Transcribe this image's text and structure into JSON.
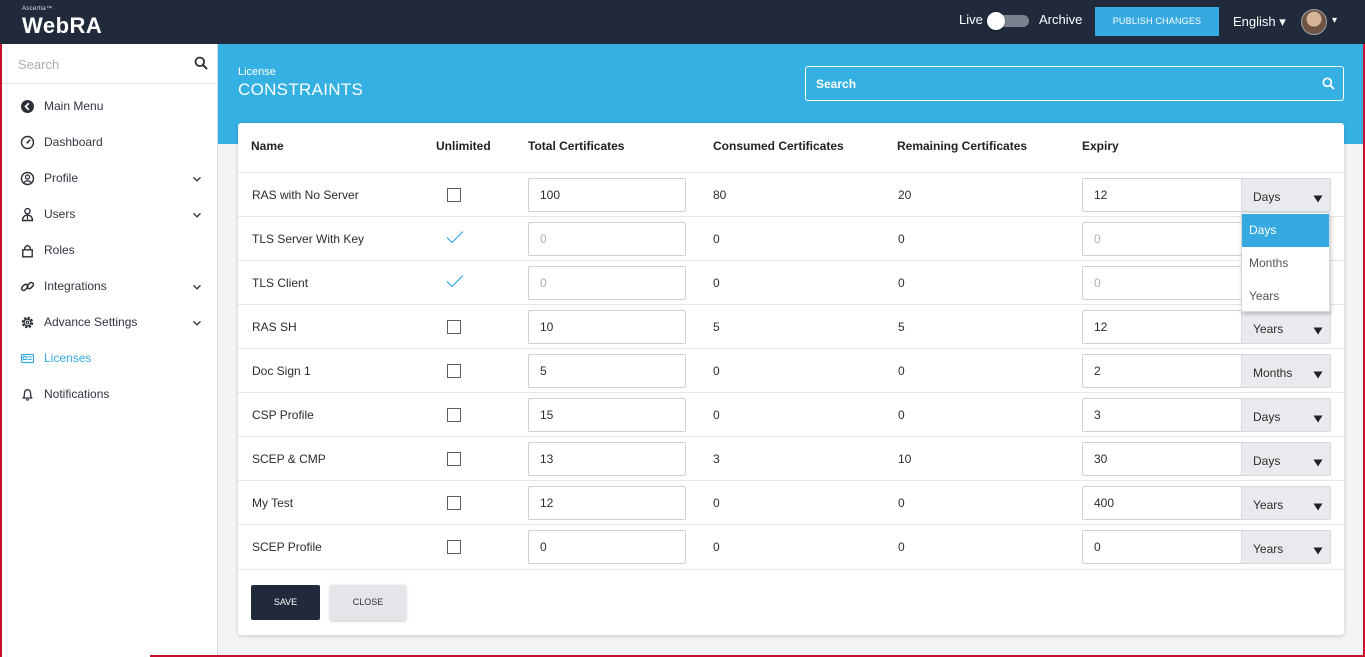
{
  "app": {
    "brand_small": "Ascertia™",
    "brand_name": "WebRA"
  },
  "topbar": {
    "live_label": "Live",
    "archive_label": "Archive",
    "publish_label": "PUBLISH CHANGES",
    "language_label": "English ▾",
    "avatar_caret": "▾"
  },
  "sidebar": {
    "search_placeholder": "Search",
    "items": [
      {
        "label": "Main Menu",
        "icon": "back-circle-icon",
        "chevron": false,
        "active": false
      },
      {
        "label": "Dashboard",
        "icon": "dashboard-gauge-icon",
        "chevron": false,
        "active": false
      },
      {
        "label": "Profile",
        "icon": "profile-icon",
        "chevron": true,
        "active": false
      },
      {
        "label": "Users",
        "icon": "users-icon",
        "chevron": true,
        "active": false
      },
      {
        "label": "Roles",
        "icon": "lock-icon",
        "chevron": false,
        "active": false
      },
      {
        "label": "Integrations",
        "icon": "link-icon",
        "chevron": true,
        "active": false
      },
      {
        "label": "Advance Settings",
        "icon": "gear-icon",
        "chevron": true,
        "active": false
      },
      {
        "label": "Licenses",
        "icon": "license-card-icon",
        "chevron": false,
        "active": true
      },
      {
        "label": "Notifications",
        "icon": "bell-icon",
        "chevron": false,
        "active": false
      }
    ]
  },
  "header": {
    "subtitle": "License",
    "title": "CONSTRAINTS",
    "search_placeholder": "Search"
  },
  "table": {
    "columns": [
      "Name",
      "Unlimited",
      "Total Certificates",
      "Consumed Certificates",
      "Remaining Certificates",
      "Expiry"
    ],
    "rows": [
      {
        "name": "RAS with No Server",
        "unlimited": false,
        "total": "100",
        "consumed": "80",
        "remaining": "20",
        "expiry": "12",
        "unit": "Days"
      },
      {
        "name": "TLS Server With Key",
        "unlimited": true,
        "total": "0",
        "consumed": "0",
        "remaining": "0",
        "expiry": "0",
        "unit": ""
      },
      {
        "name": "TLS Client",
        "unlimited": true,
        "total": "0",
        "consumed": "0",
        "remaining": "0",
        "expiry": "0",
        "unit": ""
      },
      {
        "name": "RAS SH",
        "unlimited": false,
        "total": "10",
        "consumed": "5",
        "remaining": "5",
        "expiry": "12",
        "unit": "Years"
      },
      {
        "name": "Doc Sign 1",
        "unlimited": false,
        "total": "5",
        "consumed": "0",
        "remaining": "0",
        "expiry": "2",
        "unit": "Months"
      },
      {
        "name": "CSP Profile",
        "unlimited": false,
        "total": "15",
        "consumed": "0",
        "remaining": "0",
        "expiry": "3",
        "unit": "Days"
      },
      {
        "name": "SCEP & CMP",
        "unlimited": false,
        "total": "13",
        "consumed": "3",
        "remaining": "10",
        "expiry": "30",
        "unit": "Days"
      },
      {
        "name": "My Test",
        "unlimited": false,
        "total": "12",
        "consumed": "0",
        "remaining": "0",
        "expiry": "400",
        "unit": "Years"
      },
      {
        "name": "SCEP Profile",
        "unlimited": false,
        "total": "0",
        "consumed": "0",
        "remaining": "0",
        "expiry": "0",
        "unit": "Years"
      }
    ]
  },
  "dropdown": {
    "options": [
      "Days",
      "Months",
      "Years"
    ],
    "selected": "Days"
  },
  "buttons": {
    "save_label": "SAVE",
    "close_label": "CLOSE"
  },
  "colors": {
    "topbar": "#202a3b",
    "accent": "#35a9e0",
    "hero": "#35b0e3",
    "frame": "#c8102e"
  }
}
